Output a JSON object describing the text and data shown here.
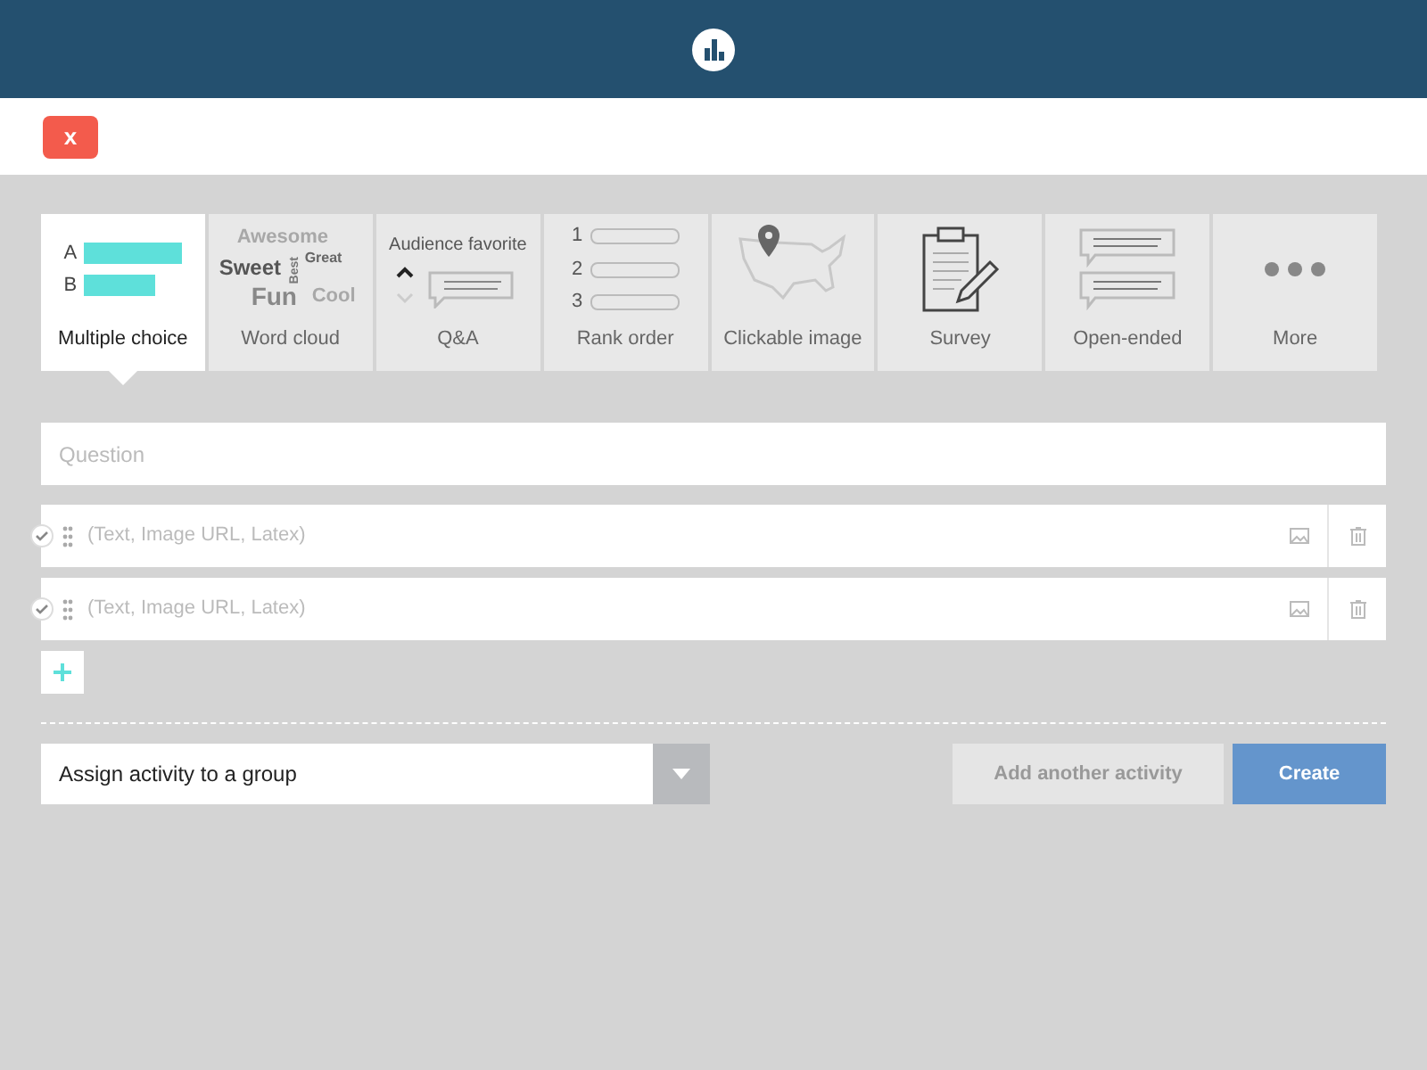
{
  "close_button": {
    "label": "x"
  },
  "tabs": [
    {
      "kind": "multiple",
      "label": "Multiple choice",
      "selected": true,
      "icon_texts": [
        "A",
        "B"
      ]
    },
    {
      "kind": "cloud",
      "label": "Word cloud",
      "selected": false,
      "icon_texts": [
        "Awesome",
        "Sweet",
        "Best",
        "Great",
        "Fun",
        "Cool"
      ]
    },
    {
      "kind": "qa",
      "label": "Q&A",
      "selected": false,
      "icon_texts": [
        "Audience favorite"
      ]
    },
    {
      "kind": "rank",
      "label": "Rank order",
      "selected": false,
      "icon_texts": [
        "1",
        "2",
        "3"
      ]
    },
    {
      "kind": "map",
      "label": "Clickable image",
      "selected": false
    },
    {
      "kind": "survey",
      "label": "Survey",
      "selected": false
    },
    {
      "kind": "open",
      "label": "Open-ended",
      "selected": false
    },
    {
      "kind": "more",
      "label": "More",
      "selected": false
    }
  ],
  "question": {
    "placeholder": "Question"
  },
  "options": [
    {
      "placeholder": "(Text, Image URL, Latex)",
      "checked": false
    },
    {
      "placeholder": "(Text, Image URL, Latex)",
      "checked": false
    }
  ],
  "group_select": {
    "value": "Assign activity to a group"
  },
  "buttons": [
    {
      "kind": "secondary",
      "label": "Add another activity"
    },
    {
      "kind": "primary",
      "label": "Create"
    }
  ]
}
